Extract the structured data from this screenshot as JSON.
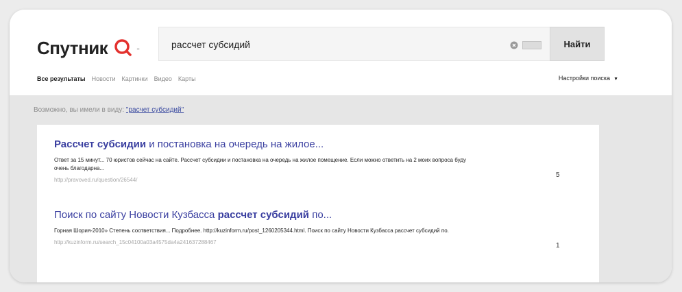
{
  "logo": {
    "text": "Спутник"
  },
  "search": {
    "query": "рассчет субсидий",
    "button_label": "Найти"
  },
  "tabs": [
    {
      "label": "Все результаты",
      "active": true
    },
    {
      "label": "Новости",
      "active": false
    },
    {
      "label": "Картинки",
      "active": false
    },
    {
      "label": "Видео",
      "active": false
    },
    {
      "label": "Карты",
      "active": false
    }
  ],
  "settings_label": "Настройки поиска",
  "suggestion": {
    "prefix": "Возможно, вы имели в виду:",
    "link": "\"расчет субсидий\""
  },
  "results": [
    {
      "title_bold": "Рассчет субсидии",
      "title_rest": " и постановка на очередь на жилое...",
      "snippet": "Ответ за 15 минут... 70 юристов сейчас на сайте. Рассчет субсидии и постановка на очередь на жилое помещение. Если можно ответить на 2 моих вопроса буду очень благодарна...",
      "url": "http://pravoved.ru/question/26544/",
      "count": "5"
    },
    {
      "title_before": "Поиск по сайту Новости Кузбасса ",
      "title_bold": "рассчет субсидий",
      "title_after": " по...",
      "snippet": "Горная Шория-2010» Степень соответствия... Подробнее. http://kuzinform.ru/post_1260205344.html. Поиск по сайту Новости Кузбасса рассчет субсидий по.",
      "url": "http://kuzinform.ru/search_15c04100a03a4575da4a241637288467",
      "count": "1"
    }
  ],
  "colors": {
    "brand_red": "#e3312e",
    "link": "#3a3fa0",
    "background": "#e6e6e6"
  },
  "icons": [
    "search-magnifier-logo-icon",
    "clear-icon",
    "keyboard-icon",
    "caret-down-icon"
  ]
}
